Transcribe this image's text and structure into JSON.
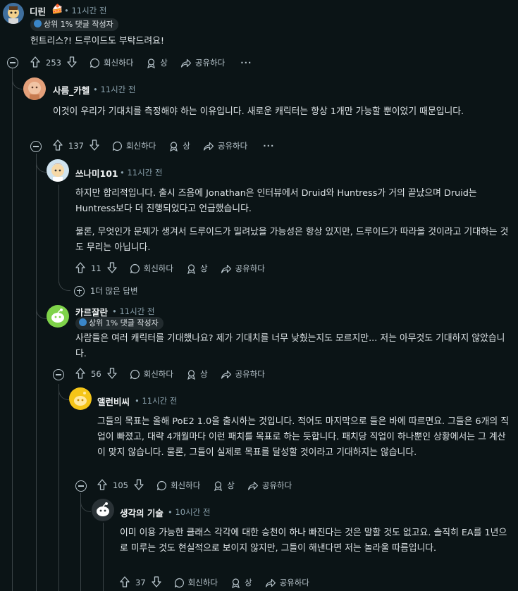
{
  "comments": [
    {
      "user": "디린",
      "time": "11시간 전",
      "flair": "상위 1% 댓글 작성자",
      "body": [
        "헌트리스?! 드루이드도 부탁드려요!"
      ],
      "votes": "253",
      "reply": "회신하다",
      "award": "상",
      "share": "공유하다",
      "more": "···"
    },
    {
      "user": "사름_카헬",
      "time": "11시간 전",
      "body": [
        "이것이 우리가 기대치를 측정해야 하는 이유입니다. 새로운 캐릭터는 항상 1개만 가능할 뿐이었기 때문입니다."
      ],
      "votes": "137",
      "reply": "회신하다",
      "award": "상",
      "share": "공유하다",
      "more": "···"
    },
    {
      "user": "쓰나미101",
      "time": "11시간 전",
      "body": [
        "하지만 합리적입니다. 출시 즈음에 Jonathan은 인터뷰에서 Druid와 Huntress가 거의 끝났으며 Druid는 Huntress보다 더 진행되었다고 언급했습니다.",
        "물론, 무엇인가 문제가 생겨서 드루이드가 밀려났을 가능성은 항상 있지만, 드루이드가 따라올 것이라고 기대하는 것도 무리는 아닙니다."
      ],
      "votes": "11",
      "reply": "회신하다",
      "award": "상",
      "share": "공유하다",
      "more_replies": "1더 많은 답변"
    },
    {
      "user": "카르잘란",
      "time": "11시간 전",
      "flair": "상위 1% 댓글 작성자",
      "body": [
        "사람들은 여러 캐릭터를 기대했나요? 제가 기대치를 너무 낮췄는지도 모르지만... 저는 아무것도 기대하지 않았습니다."
      ],
      "votes": "56",
      "reply": "회신하다",
      "award": "상",
      "share": "공유하다"
    },
    {
      "user": "앨런비씨",
      "time": "11시간 전",
      "body": [
        "그들의 목표는 올해 PoE2 1.0을 출시하는 것입니다. 적어도 마지막으로 들은 바에 따르면요. 그들은 6개의 직업이 빠졌고, 대략 4개월마다 이런 패치를 목표로 하는 듯합니다. 패치당 직업이 하나뿐인 상황에서는 그 계산이 맞지 않습니다. 물론, 그들이 실제로 목표를 달성할 것이라고 기대하지는 않습니다."
      ],
      "votes": "105",
      "reply": "회신하다",
      "award": "상",
      "share": "공유하다"
    },
    {
      "user": "생각의 기술",
      "time": "10시간 전",
      "body": [
        "이미 이용 가능한 클래스 각각에 대한 승천이 하나 빠진다는 것은 말할 것도 없고요. 솔직히 EA를 1년으로 미루는 것도 현실적으로 보이지 않지만, 그들이 해낸다면 저는 놀라울 따름입니다."
      ],
      "votes": "37",
      "reply": "회신하다",
      "award": "상",
      "share": "공유하다"
    }
  ],
  "icons": {
    "upvote": "arrow-up-icon",
    "downvote": "arrow-down-icon",
    "reply": "speech-bubble-icon",
    "award": "award-icon",
    "share": "share-arrow-icon",
    "collapse": "minus-circle-icon",
    "expand": "plus-circle-icon"
  },
  "colors": {
    "background": "#0b1416",
    "text": "#dde3e6",
    "meta": "#8ba2ad",
    "flair_bg": "#222b2e"
  }
}
